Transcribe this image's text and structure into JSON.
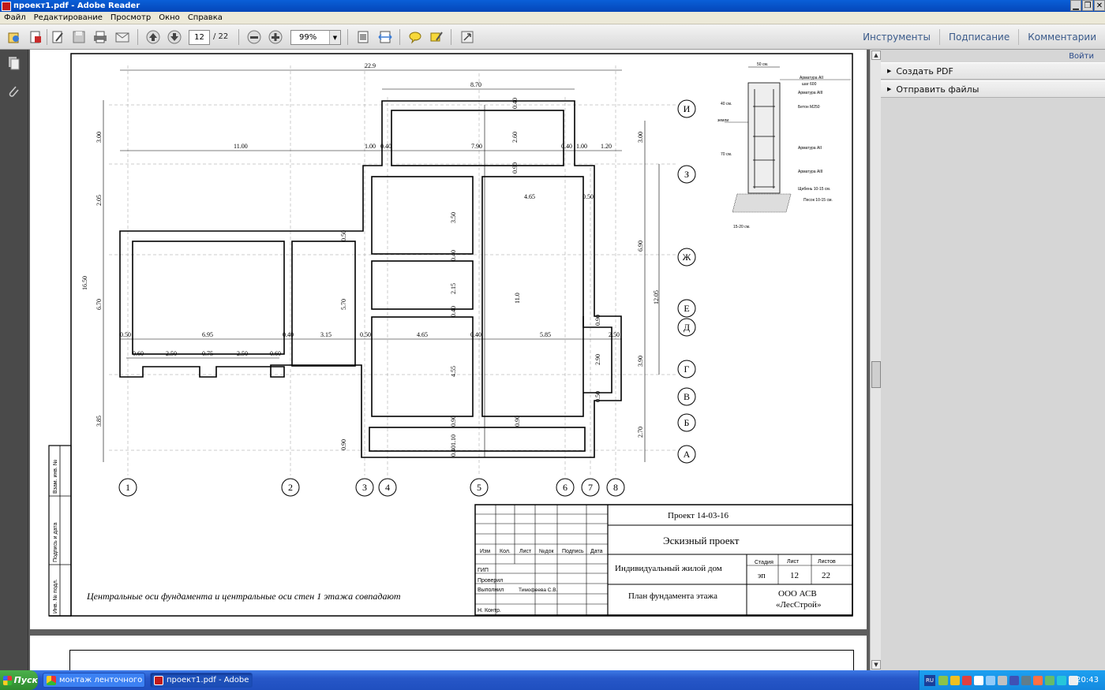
{
  "window": {
    "title": "проект1.pdf - Adobe Reader"
  },
  "menu": [
    "Файл",
    "Редактирование",
    "Просмотр",
    "Окно",
    "Справка"
  ],
  "toolbar": {
    "page_current": "12",
    "page_total": "/ 22",
    "zoom": "99%"
  },
  "tabs": [
    "Инструменты",
    "Подписание",
    "Комментарии"
  ],
  "panel": {
    "login": "Войти",
    "items": [
      "Создать PDF",
      "Отправить файлы"
    ]
  },
  "drawing": {
    "dims": [
      "22.9",
      "8.70",
      "11.00",
      "1.00",
      "0.40",
      "7.90",
      "0.40",
      "1.00",
      "1.20",
      "3.00",
      "2.05",
      "6.70",
      "16.50",
      "3.85",
      "0.40",
      "2.60",
      "0.90",
      "4.65",
      "0.50",
      "3.50",
      "0.40",
      "2.15",
      "0.40",
      "4.55",
      "0.90",
      "1.10",
      "0.40",
      "11.0",
      "0.90",
      "5.70",
      "0.50",
      "0.50",
      "6.95",
      "0.40",
      "3.15",
      "0.50",
      "4.65",
      "0.40",
      "5.85",
      "2.50",
      "0.60",
      "2.50",
      "0.75",
      "2.50",
      "0.60",
      "0.90",
      "2.90",
      "0.50",
      "3.00",
      "6.90",
      "12.05",
      "3.90",
      "2.70",
      "0.90"
    ],
    "axes_letters": [
      "И",
      "З",
      "Ж",
      "Е",
      "Д",
      "Г",
      "В",
      "Б",
      "А"
    ],
    "axes_numbers": [
      "1",
      "2",
      "3",
      "4",
      "5",
      "6",
      "7",
      "8"
    ],
    "note": "Центральные оси фундамента и центральные оси стен 1 этажа совпадают",
    "section": {
      "width_label": "50 см.",
      "labels": [
        "Арматура AII",
        "шаг 600",
        "Арматура AIII",
        "Бетон М250",
        "Арматура AII",
        "Арматура AIII",
        "Щебень 10-15 см.",
        "Песок 10-15 см."
      ],
      "side_labels": [
        "40 см.",
        "земли",
        "70 см."
      ],
      "bottom_label": "15-20 см."
    },
    "side_stamp": [
      "Взам. инв. №",
      "Подпись и дата",
      "Инв. № подл."
    ],
    "titleblock": {
      "col_heads": [
        "Изм",
        "Кол.",
        "Лист",
        "№док",
        "Подпись",
        "Дата"
      ],
      "roles": [
        "ГИП",
        "Проверил",
        "Выполнил",
        "Н. Контр."
      ],
      "executor": "Тимофеева С.В.",
      "project": "Проект  14-03-16",
      "stage_name": "Эскизный проект",
      "object": "Индивидуальный жилой дом",
      "sheet_title": "План фундамента этажа",
      "stage_head": "Стадия",
      "sheet_head": "Лист",
      "sheets_head": "Листов",
      "stage": "эп",
      "sheet": "12",
      "sheets": "22",
      "org1": "ООО АСВ",
      "org2": "«ЛесСтрой»"
    }
  },
  "taskbar": {
    "start": "Пуск",
    "tasks": [
      "монтаж ленточного фу...",
      "проект1.pdf - Adobe ..."
    ],
    "lang": "RU",
    "clock": "20:43"
  }
}
